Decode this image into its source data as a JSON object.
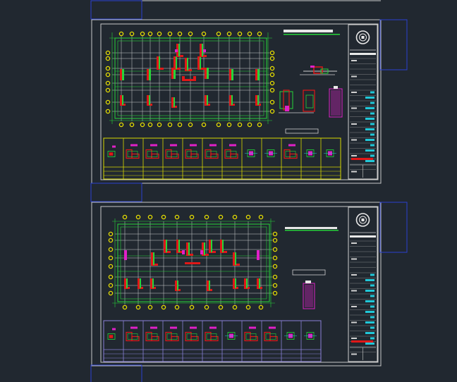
{
  "app": {
    "window_title": "",
    "background_color": "#212830"
  },
  "colors": {
    "sheet_border": "#c8c8c8",
    "viewport_frame": "#2a3fd0",
    "grid_green": "#27d43a",
    "grid_white": "#cfcfcf",
    "wall_red": "#e01818",
    "wall_magenta": "#e020c8",
    "axis_yellow": "#e8e000",
    "table_yellow": "#d8d800",
    "table_purple": "#8a80d8",
    "cyan": "#20c8d8"
  },
  "sheets": [
    {
      "name": "sheet-upper",
      "detail_table_color": "yellow",
      "title_block_text": []
    },
    {
      "name": "sheet-lower",
      "detail_table_color": "purple",
      "title_block_text": []
    }
  ]
}
